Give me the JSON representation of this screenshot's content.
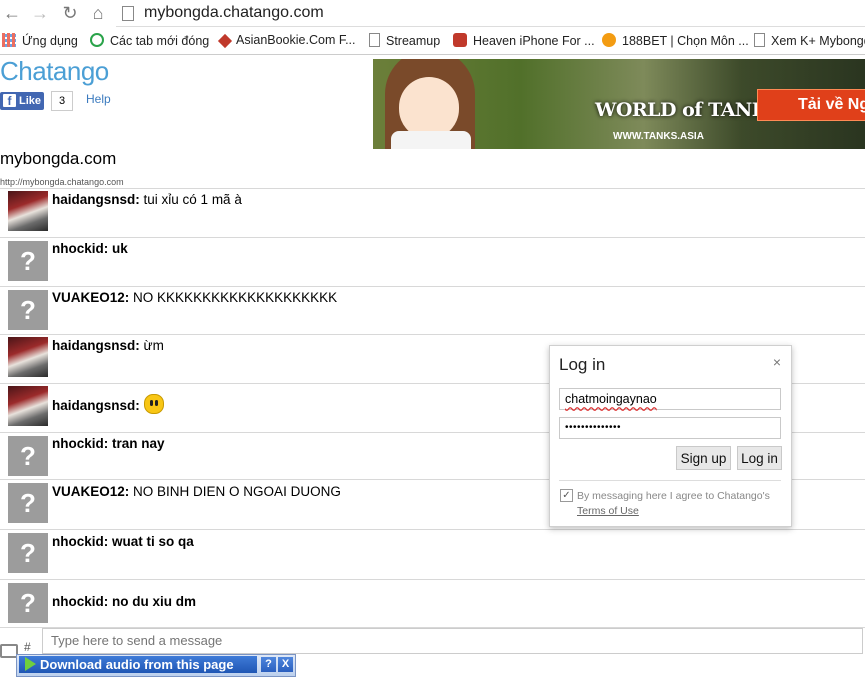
{
  "browser": {
    "url": "mybongda.chatango.com",
    "bookmarks": [
      {
        "label": "Ứng dụng",
        "icon": "apps-grid-icon",
        "color": "#e84b3a"
      },
      {
        "label": "Các tab mới đóng",
        "icon": "history-icon",
        "color": "#2aa34a"
      },
      {
        "label": "AsianBookie.Com F...",
        "icon": "asianbookie-icon",
        "color": "#c0392b"
      },
      {
        "label": "Streamup",
        "icon": "page-icon",
        "color": "#888888"
      },
      {
        "label": "Heaven iPhone For ...",
        "icon": "heaven-icon",
        "color": "#c0392b"
      },
      {
        "label": "188BET | Chọn Môn ...",
        "icon": "188bet-icon",
        "color": "#f39c12"
      },
      {
        "label": "Xem K+ Mybongd",
        "icon": "page-icon",
        "color": "#888888"
      }
    ]
  },
  "header": {
    "logo": "Chatango",
    "like_label": "Like",
    "like_count": "3",
    "help": "Help"
  },
  "ad": {
    "brand": "WORLD of TANKS",
    "site": "WWW.TANKS.ASIA",
    "cta": "Tải về Ng"
  },
  "room": {
    "title": "mybongda.com",
    "url": "http://mybongda.chatango.com"
  },
  "messages": [
    {
      "user": "haidangsnsd:",
      "text": "tui xỉu có 1 mã à",
      "avatar": "photo",
      "bold": false
    },
    {
      "user": "nhockid:",
      "text": "uk",
      "avatar": "default",
      "bold": true
    },
    {
      "user": "VUAKEO12:",
      "text": "NO KKKKKKKKKKKKKKKKKKKK",
      "avatar": "default",
      "bold": false
    },
    {
      "user": "haidangsnsd:",
      "text": "ừm",
      "avatar": "photo",
      "bold": false
    },
    {
      "user": "haidangsnsd:",
      "text": "",
      "avatar": "photo",
      "bold": false,
      "emoticon": "smiley-icon"
    },
    {
      "user": "nhockid:",
      "text": "tran nay",
      "avatar": "default",
      "bold": true
    },
    {
      "user": "VUAKEO12:",
      "text": "NO BINH DIEN O NGOAI DUONG",
      "avatar": "default",
      "bold": false
    },
    {
      "user": "nhockid:",
      "text": "wuat ti so qa",
      "avatar": "default",
      "bold": true
    },
    {
      "user": "nhockid:",
      "text": "no du xiu dm",
      "avatar": "default",
      "bold": true
    }
  ],
  "input": {
    "placeholder": "Type here to send a message",
    "hash": "#"
  },
  "download_bar": {
    "label": "Download audio from this page",
    "help": "?",
    "close": "X"
  },
  "login": {
    "title": "Log in",
    "close": "×",
    "username": "chatmoingaynao",
    "password_mask": "••••••••••••••",
    "signup": "Sign up",
    "login": "Log in",
    "agree_text": "By messaging here I agree to Chatango's",
    "terms": "Terms of Use",
    "agreed": true
  },
  "colors": {
    "logo": "#4b9fd5",
    "facebook": "#4267b2",
    "default_avatar": "#9c9c9c"
  }
}
